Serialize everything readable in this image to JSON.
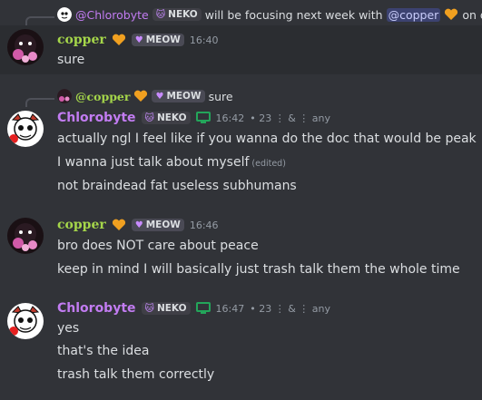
{
  "reply_top": {
    "username": "@Chlorobyte",
    "tag": "NEKO",
    "text_before": "will be focusing next week with",
    "mention": "@copper",
    "text_after": "on dra"
  },
  "msg1": {
    "username": "copper",
    "tag": "MEOW",
    "time": "16:40",
    "lines": [
      "sure"
    ]
  },
  "reply_mid": {
    "username": "@copper",
    "tag": "MEOW",
    "text": "sure"
  },
  "msg2": {
    "username": "Chlorobyte",
    "tag": "NEKO",
    "time": "16:42",
    "meta": "• 23 ⋮ & ⋮ any",
    "lines": [
      "actually ngl I feel like if you wanna do the doc that would be peak",
      "I wanna just talk about myself",
      "not braindead fat useless subhumans"
    ],
    "edited": "(edited)"
  },
  "msg3": {
    "username": "copper",
    "tag": "MEOW",
    "time": "16:46",
    "lines": [
      "bro does NOT care about peace",
      "keep in mind I will basically just trash talk them the whole time"
    ]
  },
  "msg4": {
    "username": "Chlorobyte",
    "tag": "NEKO",
    "time": "16:47",
    "meta": "• 23 ⋮ & ⋮ any",
    "lines": [
      "yes",
      "that's the idea",
      "trash talk them correctly"
    ]
  },
  "colors": {
    "background": "#313338",
    "copper_name": "#a5d64a",
    "chlorobyte_name": "#c27cf2",
    "heart": "#f0a020",
    "monitor": "#23a55a",
    "mention_bg": "#3c4270"
  }
}
